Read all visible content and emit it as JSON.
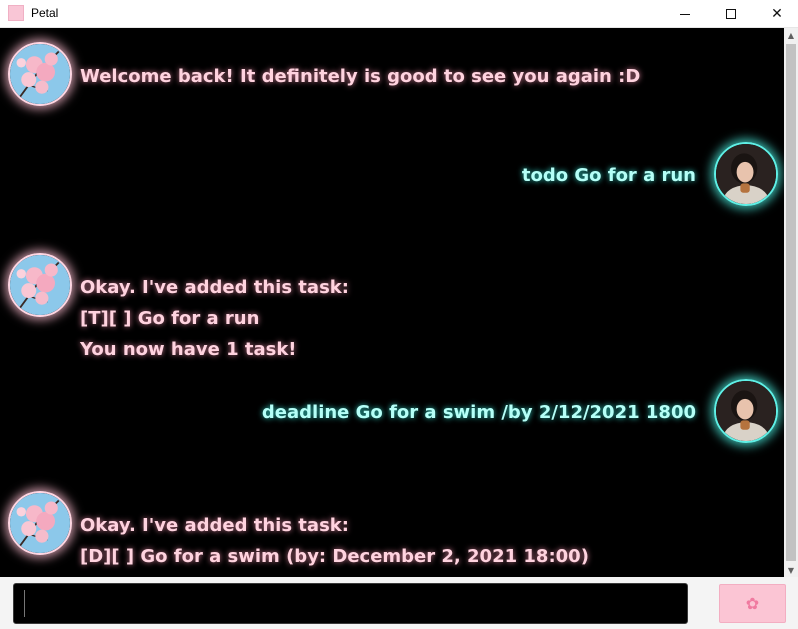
{
  "window": {
    "title": "Petal",
    "controls": {
      "minimize": "minimize-icon",
      "maximize": "maximize-icon",
      "close": "✕"
    }
  },
  "conversation": [
    {
      "sender": "bot",
      "avatar": "cherry-blossom-avatar",
      "lines": [
        "Welcome back! It definitely is good to see you again :D"
      ]
    },
    {
      "sender": "user",
      "avatar": "user-photo-avatar",
      "lines": [
        "todo Go for a run"
      ]
    },
    {
      "sender": "bot",
      "avatar": "cherry-blossom-avatar",
      "lines": [
        "Okay. I've added this task:",
        "[T][ ] Go for a run",
        "You now have 1 task!"
      ]
    },
    {
      "sender": "user",
      "avatar": "user-photo-avatar",
      "lines": [
        "deadline Go for a swim /by 2/12/2021 1800"
      ]
    },
    {
      "sender": "bot",
      "avatar": "cherry-blossom-avatar",
      "lines": [
        "Okay. I've added this task:",
        "[D][ ] Go for a swim (by: December 2, 2021 18:00)"
      ]
    }
  ],
  "input": {
    "value": "",
    "placeholder": ""
  },
  "send_button": {
    "icon": "flower-icon",
    "glyph": "✿"
  },
  "colors": {
    "bot_text": "#ffd3df",
    "user_text": "#b5fff7",
    "chat_background": "#000000",
    "send_button": "#fbc5d4"
  }
}
